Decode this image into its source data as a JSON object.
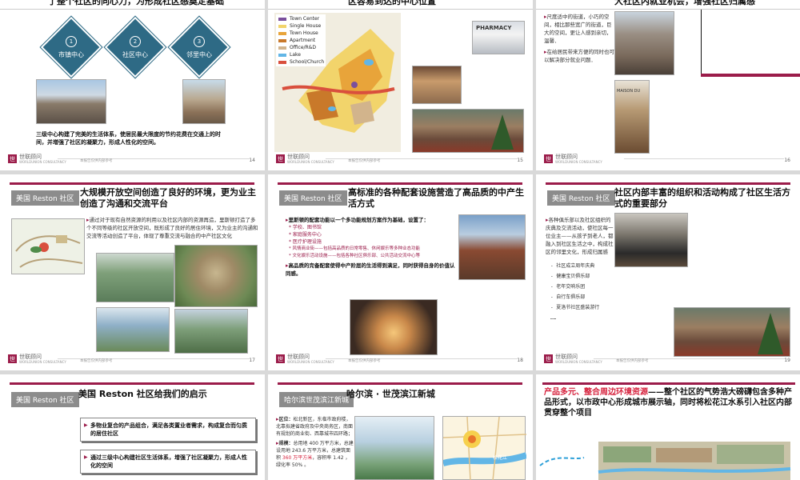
{
  "slides": [
    {
      "heading": "了整个社区的向心力，为形成社区感奠定基础",
      "diamonds": [
        {
          "num": "1",
          "label": "市镇中心"
        },
        {
          "num": "2",
          "label": "社区中心"
        },
        {
          "num": "3",
          "label": "邻里中心"
        }
      ],
      "text": "三级中心构建了完美的生活体系，使居民最大限度的节约花费在交通上的时间，并增强了社区的凝聚力，形成人性化的空间。",
      "page": "14"
    },
    {
      "heading": "区容易到达的中心位置",
      "legend": [
        {
          "label": "Town Center",
          "color": "#7b4f9c"
        },
        {
          "label": "Single House",
          "color": "#f2d46b"
        },
        {
          "label": "Town House",
          "color": "#e8a43a"
        },
        {
          "label": "Apartment",
          "color": "#c9792a"
        },
        {
          "label": "Office/R&D",
          "color": "#d2b48c"
        },
        {
          "label": "Lake",
          "color": "#62b6e6"
        },
        {
          "label": "School/Church",
          "color": "#d94f3d"
        }
      ],
      "shop_sign": "PHARMACY",
      "page": "15"
    },
    {
      "heading": "大社区内就业机会，增强社区归属感",
      "bullets": [
        "尺度适中的街道，小巧的空间，相比那些宽广的街道，巨大的空间，更让人感到亲切，温馨．",
        "在给居民带来方便的同时也可以解决部分就业问题．"
      ],
      "shop_sign": "MAISON DU",
      "page": "16"
    },
    {
      "tag": "美国 Reston 社区",
      "title": "大规模开放空间创造了良好的环境，更为业主创造了沟通和交流平台",
      "text": "通过对于现有自然资源的利用以及社区内部的资源再造，里斯顿打造了多个不同等级的社区开放空间，既形成了良好的居住环境，又为业主的沟通和交流等活动创造了平台，体现了尊重交流与融合的中产社区文化",
      "page": "17"
    },
    {
      "tag": "美国 Reston 社区",
      "title": "高标准的各种配套设施营造了高品质的中产生活方式",
      "intro": "里斯顿的配套功能以一个多功能规划方案作为基础，设置了：",
      "items": [
        "学校、图书馆",
        "家庭服务中心",
        "医疗护理设施",
        "风情商业街——包括高品质的日常零售、休闲娱乐等多种业态功能",
        "文化娱乐活动设施——包括各种社区俱乐部、公共活动交流中心等"
      ],
      "conclusion": "高品质的完备配套使得中产阶层的生活得到满足，同时获得自身的价值认同感。",
      "page": "18"
    },
    {
      "tag": "美国 Reston 社区",
      "title": "社区内部丰富的组织和活动构成了社区生活方式的重要部分",
      "intro": "各种俱乐部以及社区组织的庆典及交流活动，使社区每一位业主——从孩子到老人，都融入到社区生活之中，构成社区的邻里文化，形成归属感",
      "items": [
        "社区成立周年庆典",
        "健康宝贝俱乐部",
        "老年交响乐团",
        "自行车俱乐部",
        "夏洛节社区盛装游行",
        "……"
      ],
      "page": "19"
    },
    {
      "tag": "美国 Reston 社区",
      "title": "美国 Reston 社区给我们的启示",
      "boxes": [
        "多物业复合的产品组合，满足各类置业者需求，构成复合而匀质的居住社区",
        "通过三级中心构建社区生活体系，增强了社区凝聚力，形成人性化的空间"
      ]
    },
    {
      "tag": "哈尔滨世茂滨江新城",
      "title": "哈尔滨 · 世茂滨江新城",
      "location_label": "区位：",
      "location_text": "松北新区，东临市政府楼，北靠拟建省政府及中央商务区，南面有规划的商业街、西靠城市四环路；",
      "scale_label": "规模：",
      "scale_text_1": "总用地 400 万平方米，总建设用地 243.6 万平方米，总建筑面积 ",
      "scale_highlight": "360 万平方米",
      "scale_text_2": "，容积率 1.42 ，绿化率 50% 。",
      "river_label": "松花江"
    },
    {
      "title_red": "产品多元、整合周边环境资源",
      "title_rest": "——整个社区的气势浩大磅礴包含多种产品形式，以市政中心形成城市展示轴，同时将松花江水系引入社区内部贯穿整个项目"
    }
  ],
  "logo": {
    "mark": "世",
    "name": "世联顾问",
    "sub": "WORLDUNION CONSULTANCY"
  },
  "footer_note": "本报告仅供内部参考",
  "colors": {
    "accent": "#9b1c4a",
    "tag": "#8c8c8c",
    "diamond": "#2e6a85",
    "highlight_red": "#d6223d"
  }
}
